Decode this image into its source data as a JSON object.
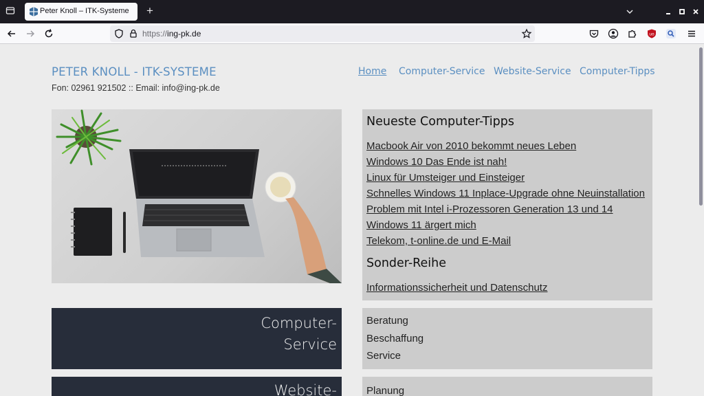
{
  "browser": {
    "tab_title": "Peter Knoll – ITK-Systeme",
    "url_scheme": "https://",
    "url_host": "ing-pk.de"
  },
  "site": {
    "title": "PETER KNOLL - ITK-SYSTEME",
    "contact": "Fon: 02961 921502 :: Email: info@ing-pk.de",
    "nav": [
      "Home",
      "Computer-Service",
      "Website-Service",
      "Computer-Tipps"
    ],
    "active_nav": "Home"
  },
  "tips_panel": {
    "heading": "Neueste Computer-Tipps",
    "links": [
      "Macbook Air von 2010 bekommt neues Leben",
      "Windows 10 Das Ende ist nah!",
      "Linux für Umsteiger und Einsteiger",
      "Schnelles Windows 11 Inplace-Upgrade ohne Neuinstallation",
      "Problem mit Intel i-Prozessoren Generation 13 und 14",
      "Windows 11 ärgert mich",
      "Telekom, t-online.de und E-Mail"
    ],
    "special_heading": "Sonder-Reihe",
    "special_links": [
      "Informationssicherheit und Datenschutz"
    ]
  },
  "computer_service": {
    "title_line1": "Computer-",
    "title_line2": "Service",
    "items": [
      "Beratung",
      "Beschaffung",
      "Service"
    ]
  },
  "website_service": {
    "title_line1": "Website-",
    "items": [
      "Planung"
    ]
  },
  "colors": {
    "accent": "#5b8fc1",
    "dark_box": "#272d3a",
    "panel": "#cccccc",
    "page_bg": "#ececec"
  },
  "icons": [
    "tab-list-icon",
    "favicon-icon",
    "new-tab-icon",
    "tab-list-chevron-icon",
    "minimize-icon",
    "maximize-icon",
    "close-icon",
    "back-icon",
    "forward-icon",
    "reload-icon",
    "shield-icon",
    "lock-icon",
    "bookmark-star-icon",
    "pocket-icon",
    "account-icon",
    "extensions-icon",
    "ublock-icon",
    "search-extension-icon",
    "menu-icon"
  ]
}
